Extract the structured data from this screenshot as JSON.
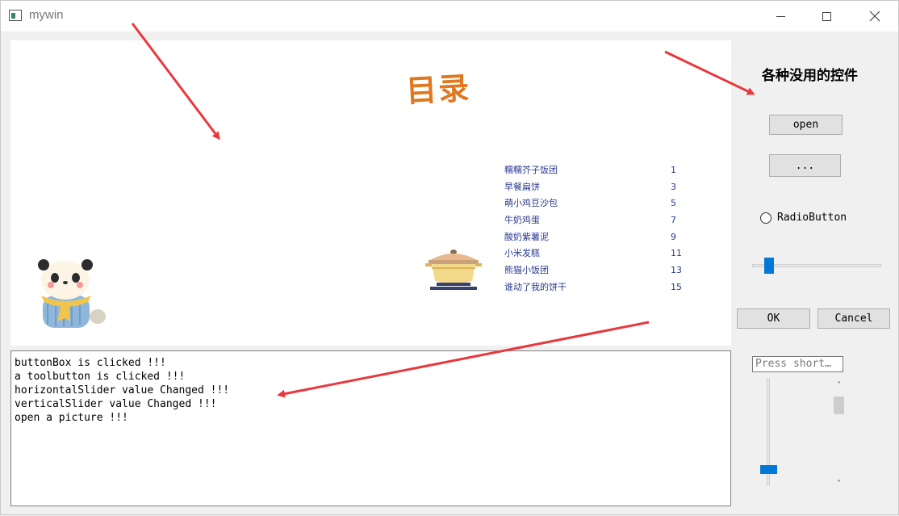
{
  "window": {
    "title": "mywin"
  },
  "picture": {
    "menu_title": "目录",
    "menu_items": [
      {
        "name": "糯糯芥子饭团",
        "price": "1"
      },
      {
        "name": "早餐扁饼",
        "price": "3"
      },
      {
        "name": "萌小鸡豆沙包",
        "price": "5"
      },
      {
        "name": "牛奶鸡蛋",
        "price": "7"
      },
      {
        "name": "酸奶紫薯泥",
        "price": "9"
      },
      {
        "name": "小米发糕",
        "price": "11"
      },
      {
        "name": "熊猫小饭团",
        "price": "13"
      },
      {
        "name": "谁动了我的饼干",
        "price": "15"
      }
    ]
  },
  "log": {
    "lines": [
      "buttonBox is clicked !!!",
      "a toolbutton is clicked !!!",
      "horizontalSlider value Changed !!!",
      "verticalSlider value Changed !!!",
      "open a picture !!!"
    ]
  },
  "side": {
    "title": "各种没用的控件",
    "open_label": "open",
    "tool_label": "...",
    "radio_label": "RadioButton",
    "ok_label": "OK",
    "cancel_label": "Cancel",
    "shortcut_placeholder": "Press short…"
  },
  "colors": {
    "accent": "#0078d7",
    "arrow": "#e8383d",
    "menu_title": "#e07820",
    "menu_text": "#2a3b8f"
  }
}
